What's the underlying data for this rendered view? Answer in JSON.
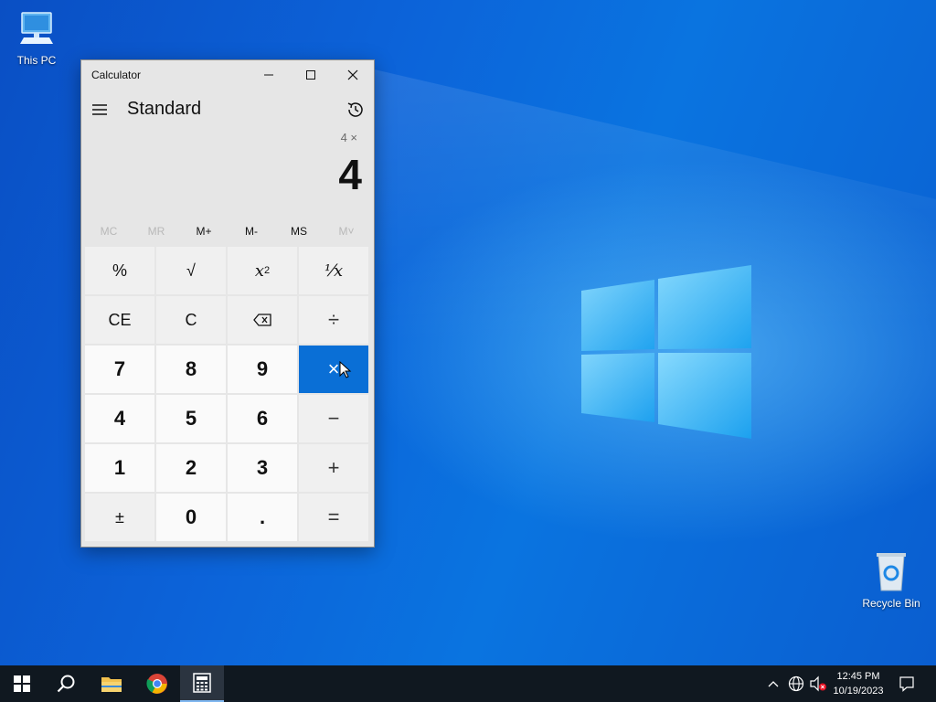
{
  "desktop": {
    "icons": [
      {
        "label": "This PC"
      },
      {
        "label": "Recycle Bin"
      }
    ]
  },
  "calculator": {
    "title": "Calculator",
    "mode": "Standard",
    "expression": "4 ×",
    "display": "4",
    "memory": [
      "MC",
      "MR",
      "M+",
      "M-",
      "MS",
      "M˅"
    ],
    "keys": [
      "%",
      "√",
      "x",
      "⅟x",
      "CE",
      "C",
      "⌫",
      "÷",
      "7",
      "8",
      "9",
      "×",
      "4",
      "5",
      "6",
      "−",
      "1",
      "2",
      "3",
      "+",
      "±",
      "0",
      ".",
      "="
    ],
    "square_exponent": "2",
    "active_key": "×"
  },
  "taskbar": {
    "time": "12:45 PM",
    "date": "10/19/2023"
  }
}
